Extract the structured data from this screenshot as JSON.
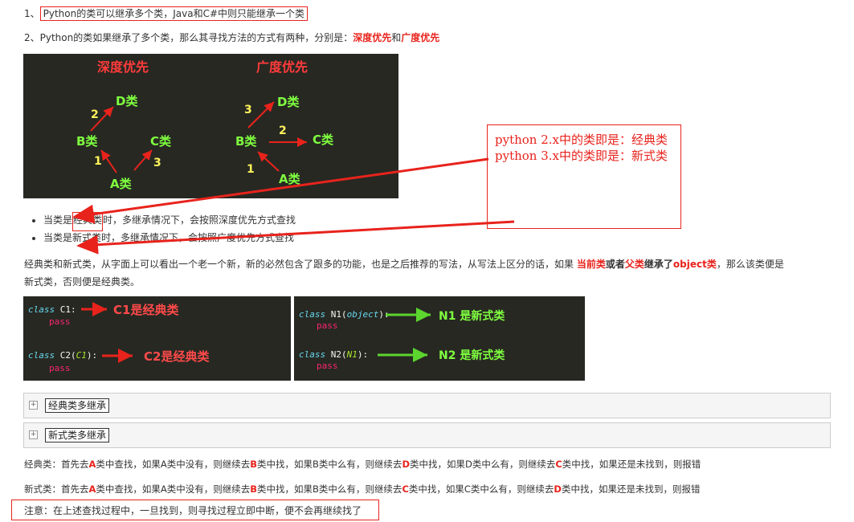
{
  "item1": {
    "num": "1、",
    "text": "Python的类可以继承多个类，Java和C#中则只能继承一个类"
  },
  "item2": {
    "prefix": "2、Python的类如果继承了多个类，那么其寻找方法的方式有两种，分别是：",
    "depth": "深度优先",
    "and": "和",
    "breadth": "广度优先"
  },
  "diagram": {
    "depth_title": "深度优先",
    "breadth_title": "广度优先",
    "node_d": "D类",
    "node_b": "B类",
    "node_c": "C类",
    "node_a": "A类",
    "n1": "1",
    "n2": "2",
    "n3": "3"
  },
  "callout": {
    "line1": "python 2.x中的类即是：经典类",
    "line2": "python 3.x中的类即是：新式类"
  },
  "bullets": [
    {
      "pre": "当类是",
      "key": "经典类",
      "post": "时，多继承情况下，会按照深度优先方式查找"
    },
    {
      "pre": "当类是",
      "key": "新式类",
      "post": "时，多继承情况下，会按照广度优先方式查找"
    }
  ],
  "para": {
    "p1": "经典类和新式类，从字面上可以看出一个老一个新，新的必然包含了跟多的功能，也是之后推荐的写法，从写法上区分的话，如果 ",
    "r1": "当前类",
    "p2": "或者",
    "r2": "父类",
    "p3": "继承了",
    "r3": "object类",
    "p4": "，那么该类便是",
    "line2": "新式类，否则便是经典类。"
  },
  "code_left": {
    "l1_kw": "class",
    "l1_rest": " C1:",
    "l1_label": "C1是经典类",
    "l2_kw": "class",
    "l2_rest": " C2(",
    "l2_arg": "C1",
    "l2_end": "):",
    "l2_label": "C2是经典类",
    "pass": "pass"
  },
  "code_right": {
    "l1_kw": "class",
    "l1_rest": " N1(",
    "l1_arg": "object",
    "l1_end": "):",
    "l1_label": "N1 是新式类",
    "l2_kw": "class",
    "l2_rest": " N2(",
    "l2_arg": "N1",
    "l2_end": "):",
    "l2_label": "N2 是新式类",
    "pass": "pass"
  },
  "folds": [
    {
      "plus": "⊞",
      "label": "经典类多继承"
    },
    {
      "plus": "⊞",
      "label": "新式类多继承"
    }
  ],
  "classic_line": {
    "a": "经典类：首先去",
    "A": "A",
    "b": "类中查找，如果A类中没有，则继续去",
    "B": "B",
    "c": "类中找，如果B类中么有，则继续去",
    "D": "D",
    "d": "类中找，如果D类中么有，则继续去",
    "C": "C",
    "e": "类中找，如果还是未找到，则报错"
  },
  "new_line": {
    "a": "新式类：首先去",
    "A": "A",
    "b": "类中查找，如果A类中没有，则继续去",
    "B": "B",
    "c": "类中找，如果B类中么有，则继续去",
    "C": "C",
    "d": "类中找，如果C类中么有，则继续去",
    "D": "D",
    "e": "类中找，如果还是未找到，则报错"
  },
  "note": "注意：在上述查找过程中，一旦找到，则寻找过程立即中断，便不会再继续找了",
  "colors": {
    "accent_red": "#e8231c",
    "panel_dark": "#272822",
    "node_green": "#7fff3f",
    "number_yellow": "#fff35a"
  }
}
